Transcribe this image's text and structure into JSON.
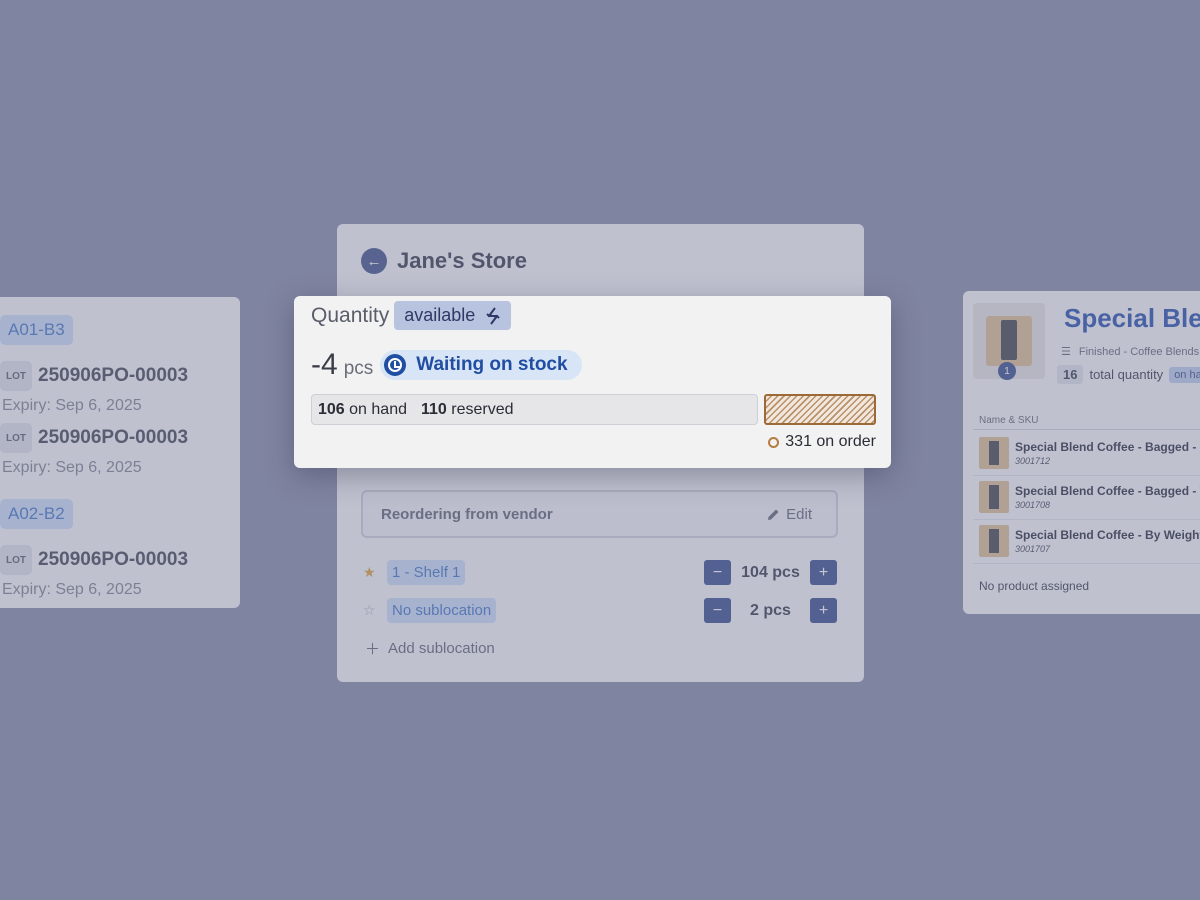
{
  "left_card": {
    "groups": [
      {
        "location": "A01-B3",
        "lots": [
          {
            "badge": "LOT",
            "number": "250906PO-00003",
            "expiry": "Expiry: Sep 6, 2025"
          },
          {
            "badge": "LOT",
            "number": "250906PO-00003",
            "expiry": "Expiry: Sep 6, 2025"
          }
        ]
      },
      {
        "location": "A02-B2",
        "lots": [
          {
            "badge": "LOT",
            "number": "250906PO-00003",
            "expiry": "Expiry: Sep 6, 2025"
          }
        ]
      }
    ]
  },
  "center_card": {
    "title": "Jane's Store",
    "back_icon": "arrow-left-icon",
    "reorder_label": "Reordering from vendor",
    "edit_label": "Edit",
    "sublocations": [
      {
        "name": "1 - Shelf 1",
        "starred": true,
        "quantity": "104 pcs"
      },
      {
        "name": "No sublocation",
        "starred": false,
        "quantity": "2 pcs"
      }
    ],
    "minus": "−",
    "plus": "+",
    "add_sublocation": "Add sublocation"
  },
  "right_card": {
    "title": "Special Blend Coffee",
    "thumb_badge": "1",
    "category": "Finished - Coffee Blends",
    "total_qty": "16",
    "total_qty_label": "total quantity",
    "on_hand_pill": "on hand",
    "column_header": "Name & SKU",
    "rows": [
      {
        "name": "Special Blend Coffee - Bagged - Coarse",
        "sku": "3001712"
      },
      {
        "name": "Special Blend Coffee - Bagged - Whole",
        "sku": "3001708"
      },
      {
        "name": "Special Blend Coffee - By Weight",
        "sku": "3001707"
      }
    ],
    "no_product": "No product assigned"
  },
  "popup": {
    "label": "Quantity",
    "mode": "available",
    "value": "-4",
    "unit": "pcs",
    "status": "Waiting on stock",
    "on_hand_num": "106",
    "on_hand_label": "on hand",
    "reserved_num": "110",
    "reserved_label": "reserved",
    "on_order_text": "331 on order"
  },
  "colors": {
    "background": "#7f84a1",
    "accent": "#1f4ea2",
    "on_order": "#9b6a36",
    "star": "#d99a2b"
  }
}
